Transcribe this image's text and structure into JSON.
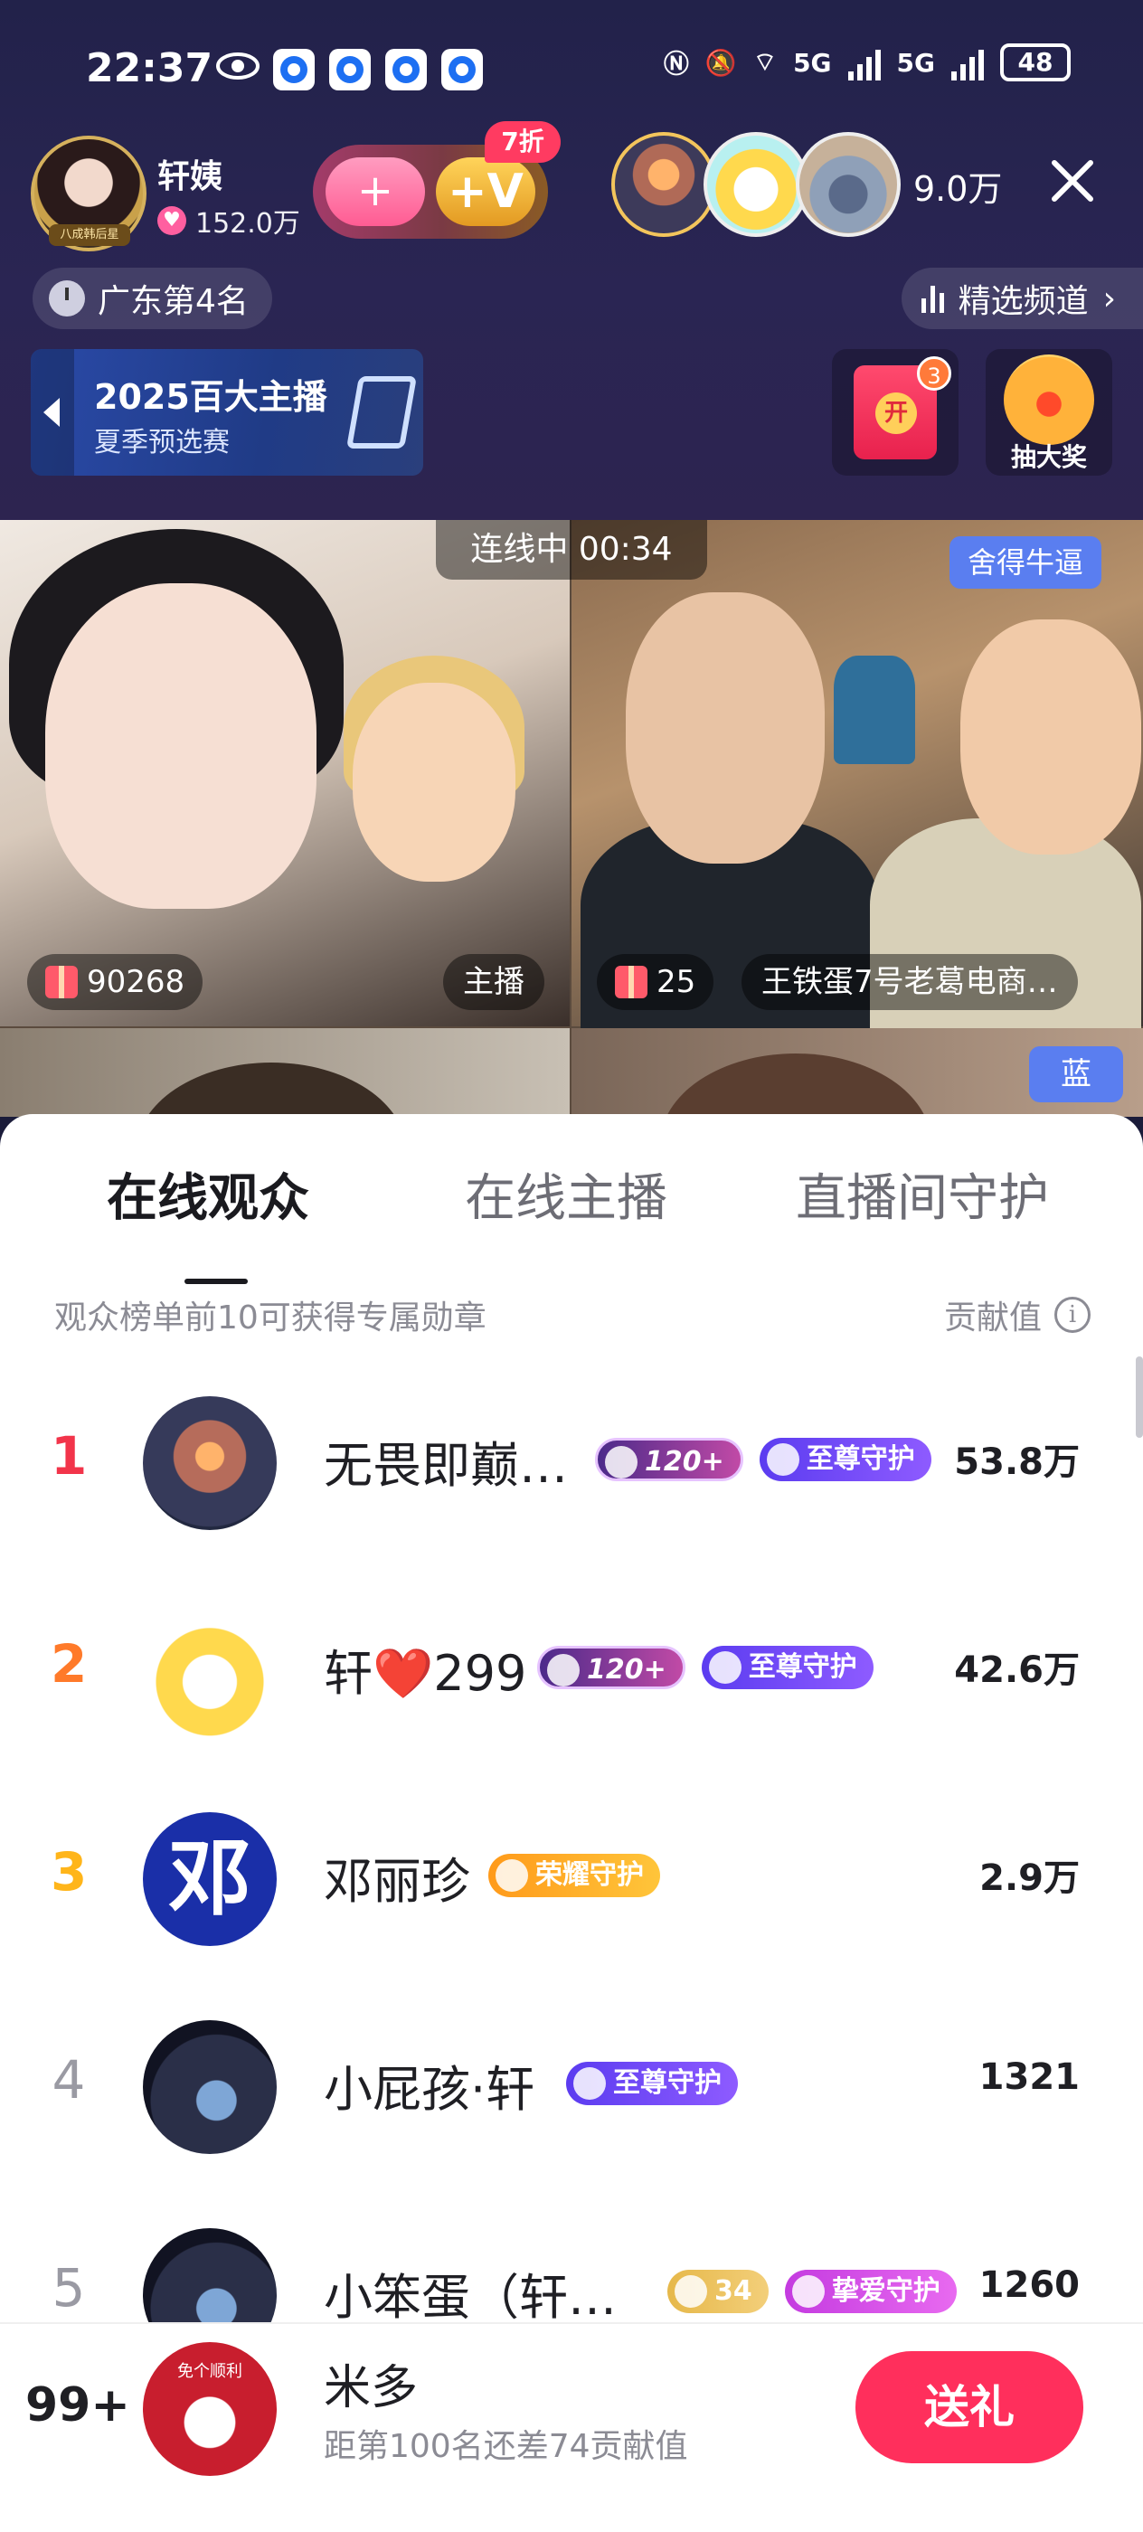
{
  "status_bar": {
    "time": "22:37",
    "network_label": "5G",
    "battery": "48"
  },
  "header": {
    "host_name": "轩姨",
    "host_badge": "八成韩后星",
    "host_likes": "152.0万",
    "fan_club_discount": "7折",
    "viewer_count": "9.0万",
    "rank_label": "广东第4名",
    "channel_label": "精选频道",
    "event_title": "2025百大主播",
    "event_subtitle": "夏季预选赛",
    "red_packet_count": "3",
    "red_packet_char": "开",
    "lottery_label": "抽大奖"
  },
  "video": {
    "connect_status": "连线中 00:34",
    "team_tag_top": "舍得牛逼",
    "team_tag_bottom": "蓝",
    "left_gift_count": "90268",
    "left_role": "主播",
    "right_gift_count": "25",
    "right_name": "王铁蛋7号老葛电商…"
  },
  "sheet": {
    "tabs": [
      {
        "label": "在线观众",
        "active": true
      },
      {
        "label": "在线主播",
        "active": false
      },
      {
        "label": "直播间守护",
        "active": false
      }
    ],
    "hint": "观众榜单前10可获得专属勋章",
    "contrib_label": "贡献值",
    "info_icon": "i",
    "rows": [
      {
        "rank": "1",
        "rank_color": "#f2344a",
        "name": "无畏即巅…",
        "badges": [
          "120+",
          "至尊守护"
        ],
        "value": "53.8万"
      },
      {
        "rank": "2",
        "rank_color": "#ff7a2a",
        "name": "轩❤️299",
        "badges": [
          "120+",
          "至尊守护"
        ],
        "value": "42.6万"
      },
      {
        "rank": "3",
        "rank_color": "#ffb51a",
        "name": "邓丽珍",
        "badges": [
          "荣耀守护"
        ],
        "value": "2.9万"
      },
      {
        "rank": "4",
        "rank_color": "#9a9aa3",
        "name": "小屁孩·轩",
        "badges": [
          "至尊守护"
        ],
        "value": "1321"
      },
      {
        "rank": "5",
        "rank_color": "#9a9aa3",
        "name": "小笨蛋（轩…",
        "badges": [
          "34",
          "挚爱守护"
        ],
        "value": "1260"
      }
    ],
    "row3_avatar_text": "邓"
  },
  "me": {
    "rank": "99+",
    "name": "米多",
    "subtitle": "距第100名还差74贡献值",
    "avatar_text": "免个顺利",
    "send_label": "送礼"
  },
  "colors": {
    "accent": "#ff2f5c",
    "rank1": "#f2344a",
    "rank2": "#ff7a2a",
    "rank3": "#ffb51a"
  }
}
